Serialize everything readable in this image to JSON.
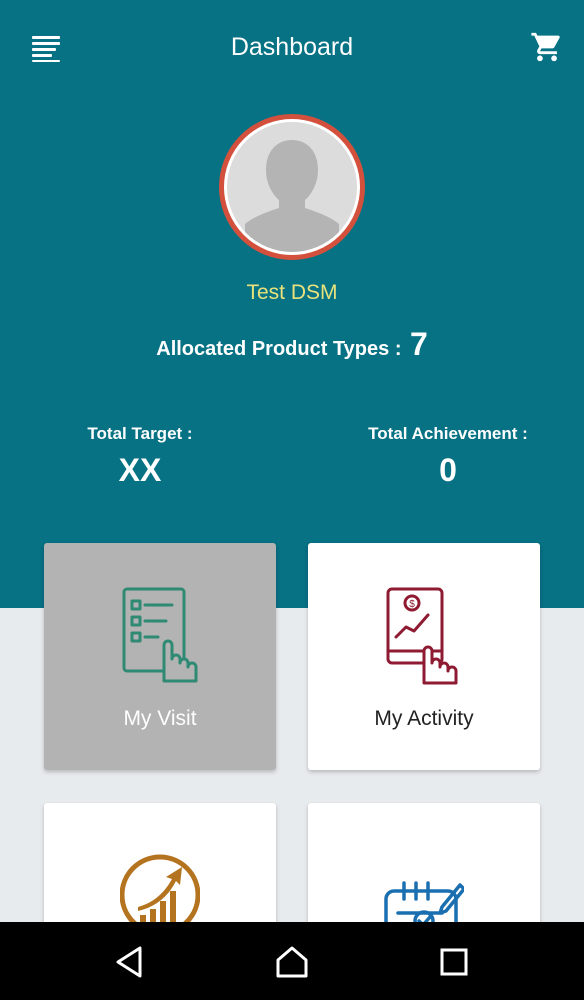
{
  "header": {
    "title": "Dashboard",
    "menu_icon": "menu-icon",
    "cart_icon": "cart-icon"
  },
  "profile": {
    "name": "Test DSM",
    "avatar_icon": "avatar-placeholder-icon"
  },
  "allocated": {
    "label": "Allocated Product Types :",
    "value": "7"
  },
  "stats": {
    "target_label": "Total Target :",
    "target_value": "XX",
    "achievement_label": "Total Achievement :",
    "achievement_value": "0"
  },
  "tiles": [
    {
      "label": "My Visit",
      "icon": "checklist-hand-icon",
      "selected": true
    },
    {
      "label": "My Activity",
      "icon": "tablet-hand-icon",
      "selected": false
    },
    {
      "label": "",
      "icon": "growth-chart-icon",
      "selected": false
    },
    {
      "label": "",
      "icon": "calendar-check-icon",
      "selected": false
    }
  ],
  "navigation": {
    "back_icon": "back-icon",
    "home_icon": "home-icon",
    "recents_icon": "recents-icon"
  },
  "colors": {
    "header_bg": "#077284",
    "page_bg": "#e8ebee",
    "avatar_border": "#d3513c",
    "name_text": "#e8e27c",
    "tile_selected_bg": "#b3b3b3",
    "visit_icon": "#2e8a73",
    "activity_icon": "#8e1b32",
    "chart_icon": "#b4731e",
    "calendar_icon": "#1a6fb0"
  }
}
